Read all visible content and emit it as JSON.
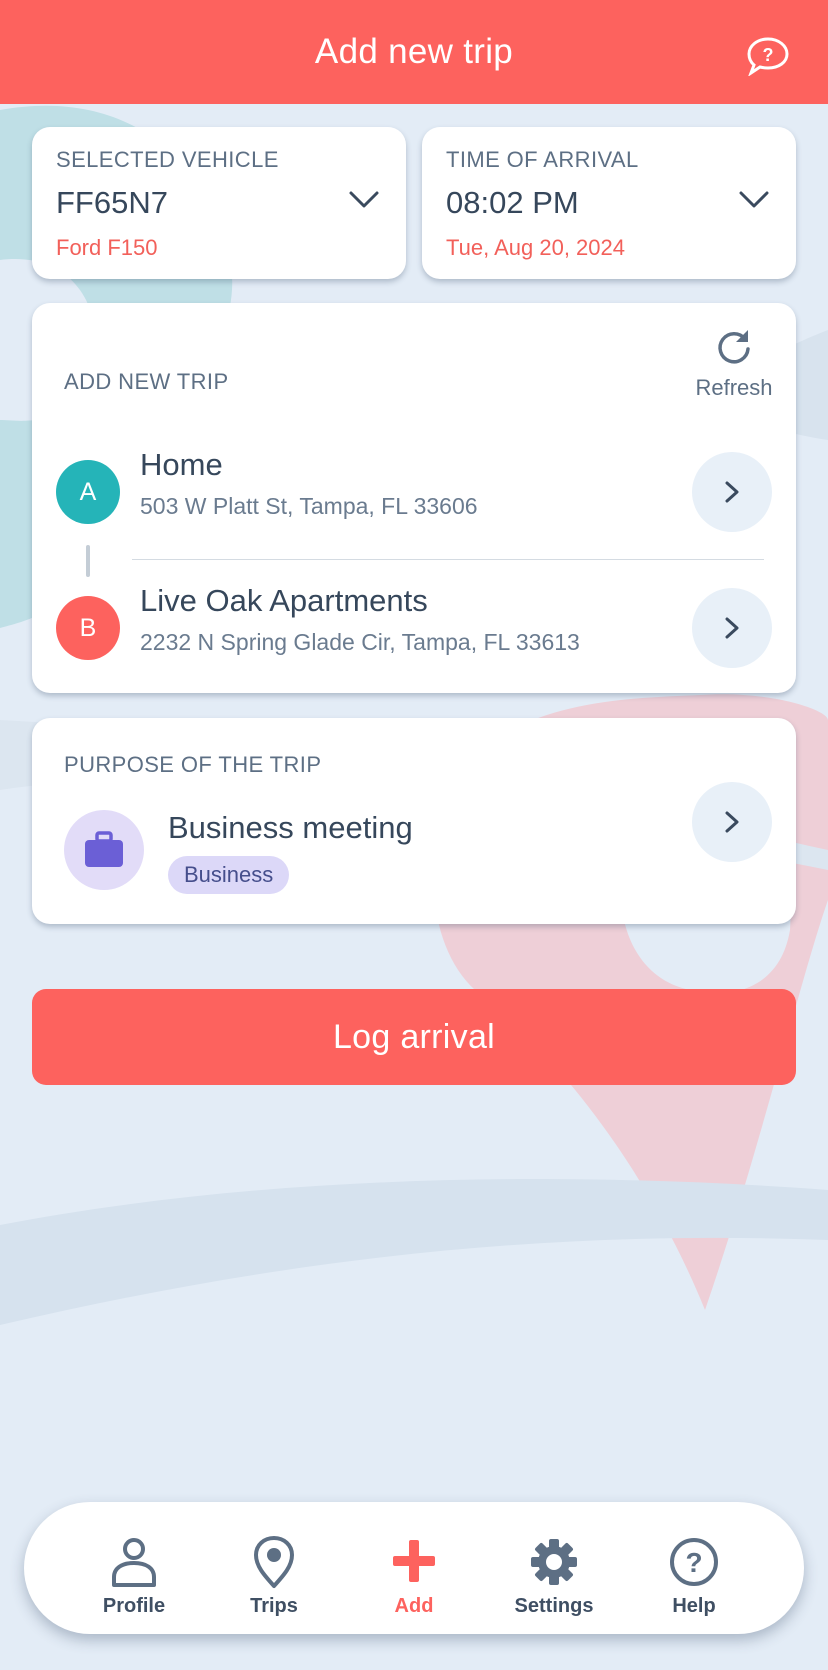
{
  "header": {
    "title": "Add new trip"
  },
  "vehicle": {
    "label": "SELECTED VEHICLE",
    "plate": "FF65N7",
    "model": "Ford F150"
  },
  "arrival": {
    "label": "TIME OF ARRIVAL",
    "time": "08:02 PM",
    "date": "Tue, Aug 20, 2024"
  },
  "route": {
    "label": "ADD NEW TRIP",
    "refresh_label": "Refresh",
    "stops": [
      {
        "badge": "A",
        "name": "Home",
        "address": "503 W Platt St, Tampa,  FL 33606"
      },
      {
        "badge": "B",
        "name": "Live Oak Apartments",
        "address": "2232 N Spring Glade Cir, Tampa,  FL 33613"
      }
    ]
  },
  "purpose": {
    "label": "PURPOSE OF THE TRIP",
    "name": "Business meeting",
    "tag": "Business",
    "icon": "briefcase-icon"
  },
  "log_button": "Log arrival",
  "tabs": [
    {
      "label": "Profile",
      "icon": "person-icon"
    },
    {
      "label": "Trips",
      "icon": "map-pin-icon"
    },
    {
      "label": "Add",
      "icon": "plus-icon",
      "active": true
    },
    {
      "label": "Settings",
      "icon": "gear-icon"
    },
    {
      "label": "Help",
      "icon": "question-icon"
    }
  ],
  "colors": {
    "accent": "#fd625e",
    "teal": "#25b4b8",
    "purple": "#6b5fd6",
    "background": "#e3ecf6"
  }
}
